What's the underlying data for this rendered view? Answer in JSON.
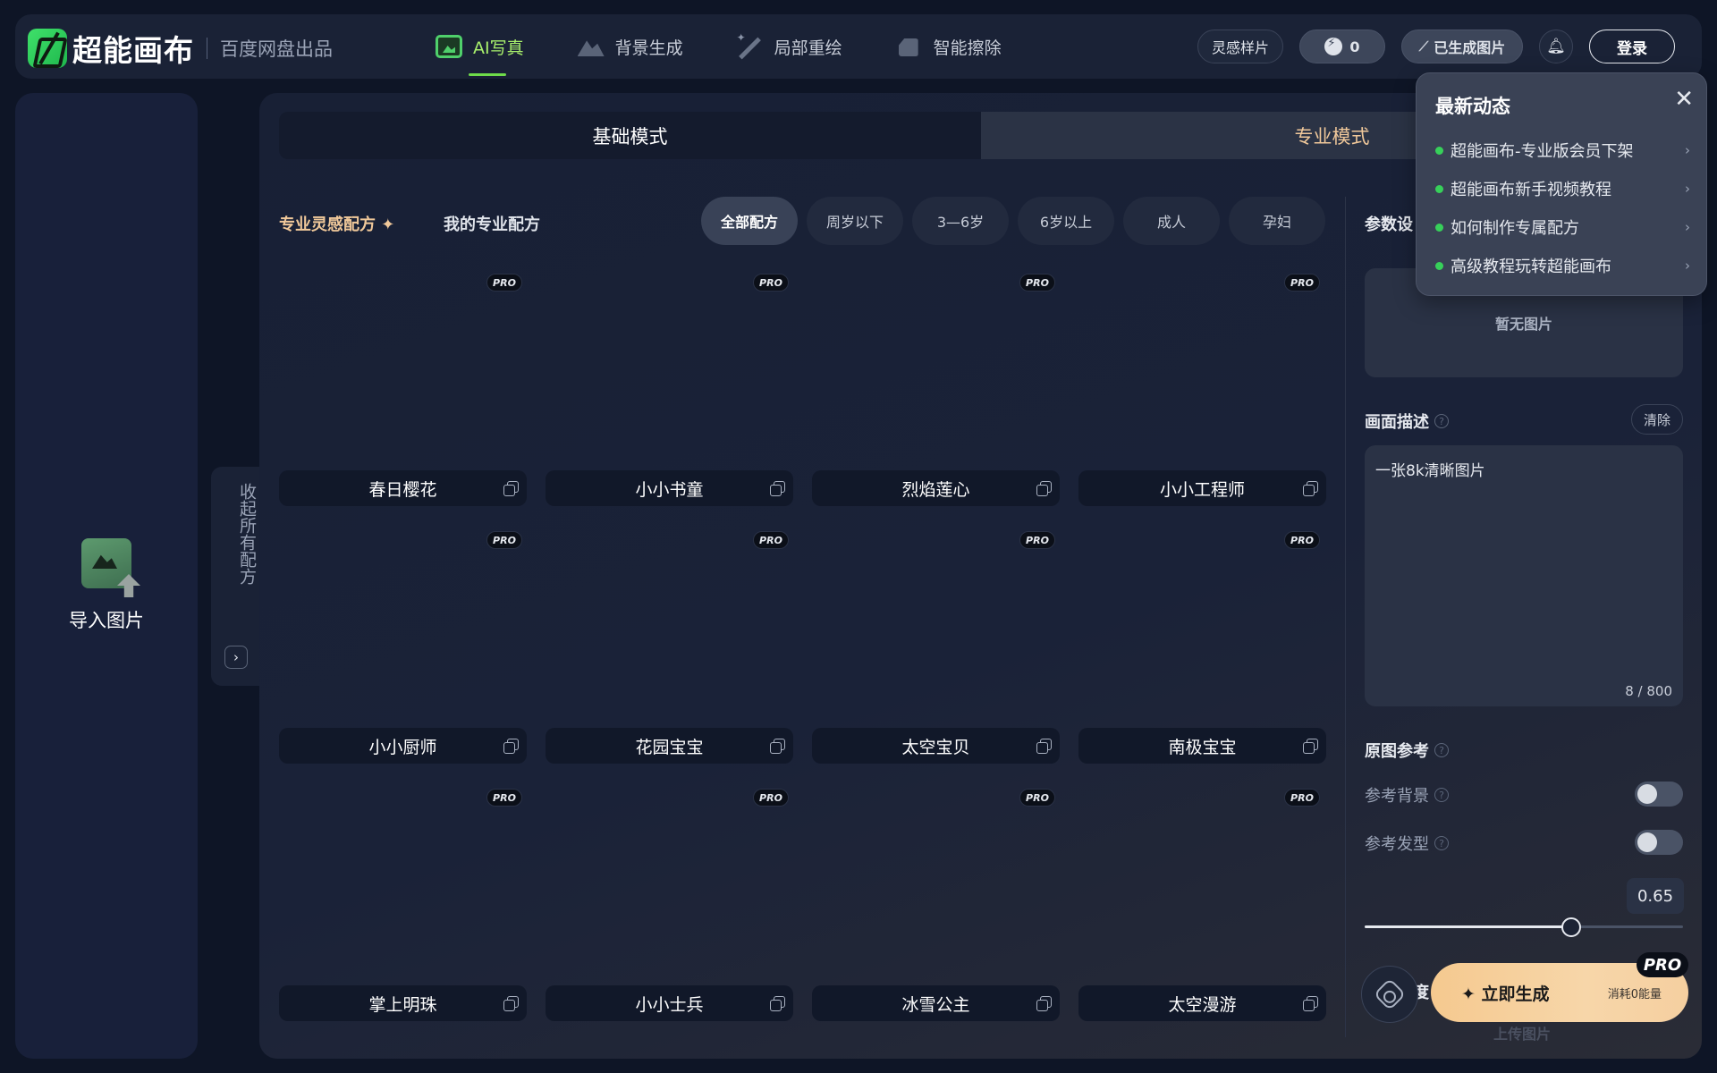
{
  "header": {
    "logo_name": "超能画布",
    "logo_sub": "百度网盘出品",
    "nav": [
      {
        "label": "AI写真",
        "icon": "portrait-icon",
        "active": true
      },
      {
        "label": "背景生成",
        "icon": "mountain-icon",
        "active": false
      },
      {
        "label": "局部重绘",
        "icon": "magic-wand-icon",
        "active": false
      },
      {
        "label": "智能擦除",
        "icon": "eraser-icon",
        "active": false
      }
    ],
    "inspiration_label": "灵感样片",
    "energy_count": "0",
    "generated_label": "已生成图片",
    "login_label": "登录"
  },
  "left_panel": {
    "import_label": "导入图片",
    "collapse_label": "收起所有配方"
  },
  "modes": {
    "basic": "基础模式",
    "pro": "专业模式"
  },
  "filters": {
    "inspiration_link": "专业灵感配方",
    "my_link": "我的专业配方",
    "chips": [
      {
        "label": "全部配方",
        "active": true
      },
      {
        "label": "周岁以下",
        "active": false
      },
      {
        "label": "3—6岁",
        "active": false
      },
      {
        "label": "6岁以上",
        "active": false
      },
      {
        "label": "成人",
        "active": false
      },
      {
        "label": "孕妇",
        "active": false
      }
    ]
  },
  "recipes": [
    {
      "name": "春日樱花",
      "badge": "PRO"
    },
    {
      "name": "小小书童",
      "badge": "PRO"
    },
    {
      "name": "烈焰莲心",
      "badge": "PRO"
    },
    {
      "name": "小小工程师",
      "badge": "PRO"
    },
    {
      "name": "小小厨师",
      "badge": "PRO"
    },
    {
      "name": "花园宝宝",
      "badge": "PRO"
    },
    {
      "name": "太空宝贝",
      "badge": "PRO"
    },
    {
      "name": "南极宝宝",
      "badge": "PRO"
    },
    {
      "name": "掌上明珠",
      "badge": "PRO"
    },
    {
      "name": "小小士兵",
      "badge": "PRO"
    },
    {
      "name": "冰雪公主",
      "badge": "PRO"
    },
    {
      "name": "太空漫游",
      "badge": "PRO"
    }
  ],
  "settings": {
    "title": "参数设",
    "no_image": "暂无图片",
    "desc_label": "画面描述",
    "clear_label": "清除",
    "desc_value": "一张8k清晰图片",
    "desc_count": "8 / 800",
    "ref_label": "原图参考",
    "ref_bg_label": "参考背景",
    "ref_bg_on": false,
    "ref_hair_label": "参考发型",
    "ref_hair_on": false,
    "beauty_label": "美颜幅度",
    "beauty_value": "0.65",
    "beauty_fraction": 0.65
  },
  "action": {
    "generate_label": "立即生成",
    "cost_label": "消耗0能量",
    "pro_badge": "PRO",
    "upload_ghost": "上传图片"
  },
  "news": {
    "title": "最新动态",
    "items": [
      "超能画布-专业版会员下架",
      "超能画布新手视频教程",
      "如何制作专属配方",
      "高级教程玩转超能画布"
    ]
  },
  "colors": {
    "accent_green": "#37d05a",
    "accent_gold": "#f0c89a",
    "background": "#0e1526"
  }
}
